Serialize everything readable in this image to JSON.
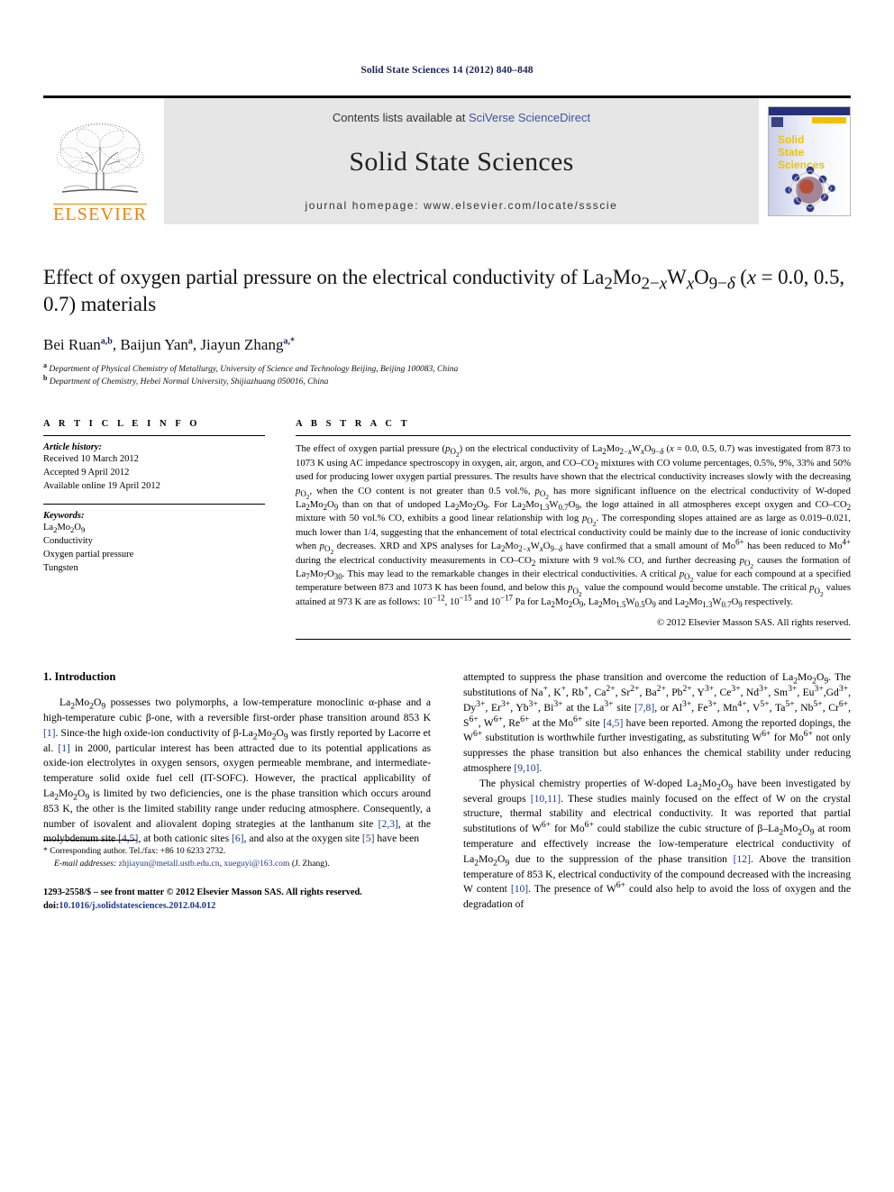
{
  "running_head": "Solid State Sciences 14 (2012) 840–848",
  "masthead": {
    "contents_prefix": "Contents lists available at ",
    "sciencedirect_link": "SciVerse ScienceDirect",
    "journal_title": "Solid State Sciences",
    "homepage": "journal homepage: www.elsevier.com/locate/ssscie",
    "publisher_wordmark": "ELSEVIER",
    "cover_lines": [
      "Solid",
      "State",
      "Sciences"
    ],
    "accent_orange": "#ef8200",
    "link_blue": "#3a55a5",
    "panel_gray": "#e6e6e6"
  },
  "title": {
    "line1": "Effect of oxygen partial pressure on the electrical conductivity of La",
    "full_plain": "Effect of oxygen partial pressure on the electrical conductivity of La2Mo2−xWxO9−δ (x = 0.0, 0.5, 0.7) materials"
  },
  "authors": {
    "plain": "Bei Ruan a,b, Baijun Yan a, Jiayun Zhang a,*",
    "list": [
      {
        "name": "Bei Ruan",
        "marks": "a,b"
      },
      {
        "name": "Baijun Yan",
        "marks": "a"
      },
      {
        "name": "Jiayun Zhang",
        "marks": "a,*"
      }
    ]
  },
  "affiliations": [
    {
      "mark": "a",
      "text": "Department of Physical Chemistry of Metallurgy, University of Science and Technology Beijing, Beijing 100083, China"
    },
    {
      "mark": "b",
      "text": "Department of Chemistry, Hebei Normal University, Shijiazhuang 050016, China"
    }
  ],
  "article_info": {
    "heading": "A R T I C L E   I N F O",
    "history_label": "Article history:",
    "history": [
      "Received 10 March 2012",
      "Accepted 9 April 2012",
      "Available online 19 April 2012"
    ],
    "keywords_label": "Keywords:",
    "keywords": [
      "La2Mo2O9",
      "Conductivity",
      "Oxygen partial pressure",
      "Tungsten"
    ]
  },
  "abstract": {
    "heading": "A B S T R A C T",
    "copyright": "© 2012 Elsevier Masson SAS. All rights reserved."
  },
  "introduction": {
    "heading": "1. Introduction"
  },
  "footnote": {
    "corresponding": "* Corresponding author. Tel./fax: +86 10 6233 2732.",
    "email_label": "E-mail addresses:",
    "email1": "zhjiayun@metall.ustb.edu.cn",
    "email2": "xueguyi@163.com",
    "email_suffix": "(J. Zhang).",
    "frontmatter": "1293-2558/$ – see front matter © 2012 Elsevier Masson SAS. All rights reserved.",
    "doi_label": "doi:",
    "doi": "10.1016/j.solidstatesciences.2012.04.012"
  }
}
